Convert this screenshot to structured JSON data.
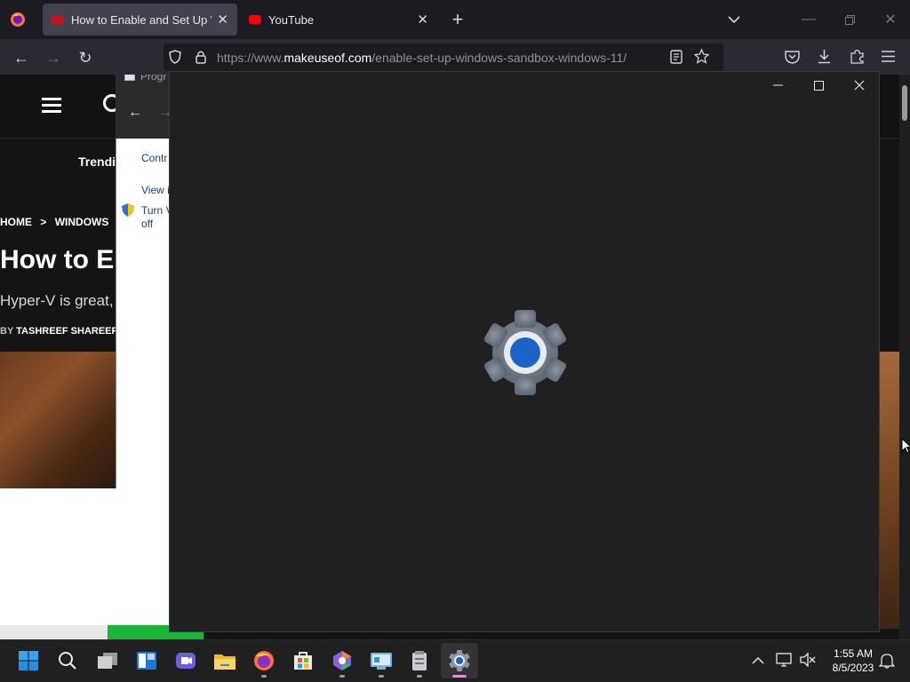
{
  "browser": {
    "tabs": [
      {
        "title": "How to Enable and Set Up Wind",
        "active": true
      },
      {
        "title": "YouTube",
        "active": false
      }
    ],
    "url_prefix": "https://www.",
    "url_domain": "makeuseof.com",
    "url_path": "/enable-set-up-windows-sandbox-windows-11/"
  },
  "webpage": {
    "nav_trending": "Trendi",
    "breadcrumb_home": "HOME",
    "breadcrumb_sep": ">",
    "breadcrumb_section": "WINDOWS",
    "article_title": "How to E",
    "article_subtitle": "Hyper-V is great,",
    "byline_prefix": "BY",
    "byline_author": "TASHREEF SHAREEF"
  },
  "programs_window": {
    "title": "Progr",
    "links": [
      "Contr",
      "View i",
      "Turn V",
      "off"
    ]
  },
  "settings_window": {
    "state": "loading",
    "icon": "settings-gear-icon",
    "accent": "#1a64c8"
  },
  "taskbar": {
    "time": "1:55 AM",
    "date": "8/5/2023",
    "apps": [
      "start-icon",
      "search-icon",
      "task-view-icon",
      "widgets-icon",
      "teams-chat-icon",
      "file-explorer-icon",
      "firefox-icon",
      "microsoft-store-icon",
      "app-icon",
      "control-panel-icon",
      "sandbox-icon",
      "settings-icon"
    ]
  },
  "colors": {
    "titlebar": "#1c1b22",
    "settings_bg": "#202020",
    "taskbar": "#202020"
  }
}
